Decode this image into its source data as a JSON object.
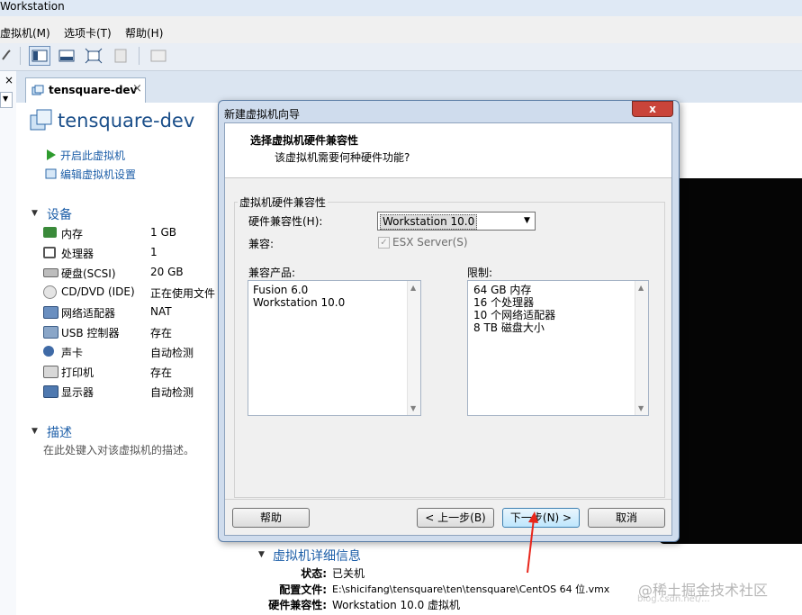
{
  "app": {
    "title": "Workstation"
  },
  "menu": [
    "虚拟机(M)",
    "选项卡(T)",
    "帮助(H)"
  ],
  "tab": {
    "label": "tensquare-dev",
    "close": "×"
  },
  "vm": {
    "name": "tensquare-dev",
    "actions": [
      "开启此虚拟机",
      "编辑虚拟机设置"
    ],
    "devices_title": "设备",
    "devices": [
      {
        "name": "内存",
        "value": "1 GB",
        "icon": "memory-icon"
      },
      {
        "name": "处理器",
        "value": "1",
        "icon": "cpu-icon"
      },
      {
        "name": "硬盘(SCSI)",
        "value": "20 GB",
        "icon": "harddisk-icon"
      },
      {
        "name": "CD/DVD (IDE)",
        "value": "正在使用文件",
        "icon": "cdrom-icon"
      },
      {
        "name": "网络适配器",
        "value": "NAT",
        "icon": "network-icon"
      },
      {
        "name": "USB 控制器",
        "value": "存在",
        "icon": "usb-icon"
      },
      {
        "name": "声卡",
        "value": "自动检测",
        "icon": "sound-icon"
      },
      {
        "name": "打印机",
        "value": "存在",
        "icon": "printer-icon"
      },
      {
        "name": "显示器",
        "value": "自动检测",
        "icon": "display-icon"
      }
    ],
    "description_title": "描述",
    "description_placeholder": "在此处键入对该虚拟机的描述。"
  },
  "details": {
    "title": "虚拟机详细信息",
    "rows": [
      {
        "label": "状态:",
        "value": "已关机"
      },
      {
        "label": "配置文件:",
        "value": "E:\\shicifang\\tensquare\\ten\\tensquare\\CentOS 64 位.vmx"
      },
      {
        "label": "硬件兼容性:",
        "value": "Workstation 10.0 虚拟机"
      }
    ]
  },
  "watermark": {
    "main": "@稀土掘金技术社区",
    "url": "blog.csdn.net/..."
  },
  "dialog": {
    "title": "新建虚拟机向导",
    "close": "x",
    "heading": "选择虚拟机硬件兼容性",
    "subheading": "该虚拟机需要何种硬件功能?",
    "group_title": "虚拟机硬件兼容性",
    "compat_label": "硬件兼容性(H):",
    "compat_value": "Workstation 10.0",
    "compatible_label": "兼容:",
    "esx_label": "ESX Server(S)",
    "esx_checked": true,
    "products_label": "兼容产品:",
    "products": [
      "Fusion 6.0",
      "Workstation 10.0"
    ],
    "limits_label": "限制:",
    "limits": [
      "64 GB 内存",
      "16 个处理器",
      "10 个网络适配器",
      "8 TB 磁盘大小"
    ],
    "buttons": {
      "help": "帮助",
      "back": "< 上一步(B)",
      "next": "下一步(N) >",
      "cancel": "取消"
    }
  },
  "colors": {
    "link": "#1c5ea8",
    "arrow": "#e8261b",
    "close_button": "#c9443a"
  }
}
